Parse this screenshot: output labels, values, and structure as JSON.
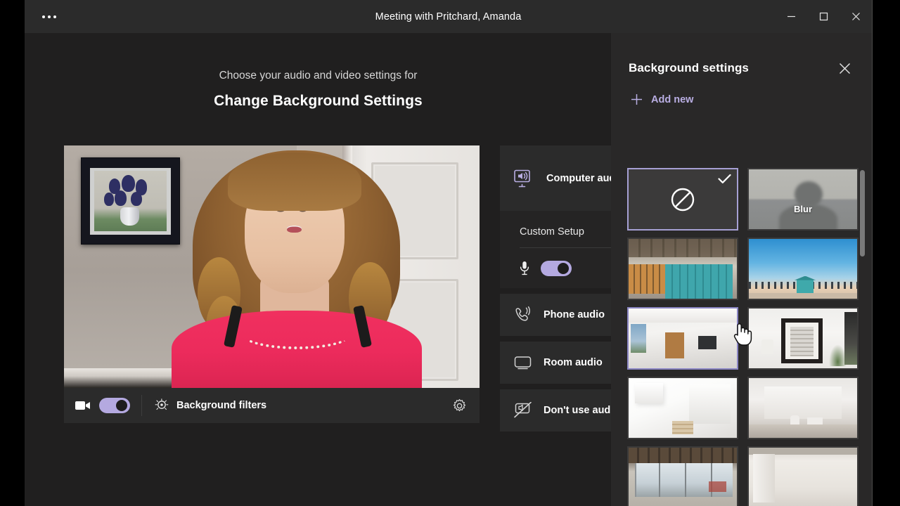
{
  "window": {
    "title": "Meeting with Pritchard, Amanda",
    "overflow_icon": "ellipsis-icon",
    "controls": [
      {
        "name": "minimize",
        "icon": "minimize-icon"
      },
      {
        "name": "maximize",
        "icon": "maximize-icon"
      },
      {
        "name": "close",
        "icon": "close-icon"
      }
    ]
  },
  "prejoin": {
    "subtitle": "Choose your audio and video settings for",
    "title": "Change Background Settings"
  },
  "video": {
    "camera_toggle_state": "on",
    "camera_icon": "video-camera-icon",
    "background_filters_label": "Background filters",
    "background_filters_icon": "sparkle-filter-icon",
    "settings_icon": "gear-icon"
  },
  "audio_options": {
    "computer_audio": {
      "label": "Computer audio",
      "icon": "computer-speaker-icon",
      "selected": true
    },
    "custom_setup": {
      "title": "Custom Setup",
      "mic_icon": "microphone-icon",
      "mic_toggle_state": "on",
      "speaker_icon": "speaker-icon"
    },
    "phone_audio": {
      "label": "Phone audio",
      "icon": "phone-icon"
    },
    "room_audio": {
      "label": "Room audio",
      "icon": "monitor-icon"
    },
    "no_audio": {
      "label": "Don't use audio",
      "icon": "monitor-slash-icon"
    }
  },
  "background_panel": {
    "title": "Background settings",
    "close_icon": "close-icon",
    "add_new_label": "Add new",
    "add_new_icon": "plus-icon",
    "accent_color": "#b9aee3",
    "selection_border_color": "#a6a0d4",
    "thumbnails": [
      {
        "name": "none",
        "label": "",
        "art": "t-none",
        "selected": true,
        "icon": "no-background-icon"
      },
      {
        "name": "blur",
        "label": "Blur",
        "art": "t-blur",
        "selected": false
      },
      {
        "name": "office-lockers",
        "label": "",
        "art": "t-office",
        "selected": false
      },
      {
        "name": "beach-lifeguard-tower",
        "label": "",
        "art": "t-beach",
        "selected": false
      },
      {
        "name": "white-room-window",
        "label": "",
        "art": "t-room-white",
        "selected": false,
        "hovered": true
      },
      {
        "name": "room-with-mirror",
        "label": "",
        "art": "t-mirror",
        "selected": false
      },
      {
        "name": "white-loft-stairs",
        "label": "",
        "art": "t-white-loft",
        "selected": false
      },
      {
        "name": "white-gallery",
        "label": "",
        "art": "t-gallery",
        "selected": false
      },
      {
        "name": "loft-windows-city",
        "label": "",
        "art": "t-window-loft",
        "selected": false
      },
      {
        "name": "plain-white-room",
        "label": "",
        "art": "t-plain-room",
        "selected": false
      }
    ]
  },
  "cursor": {
    "type": "pointing-hand"
  }
}
